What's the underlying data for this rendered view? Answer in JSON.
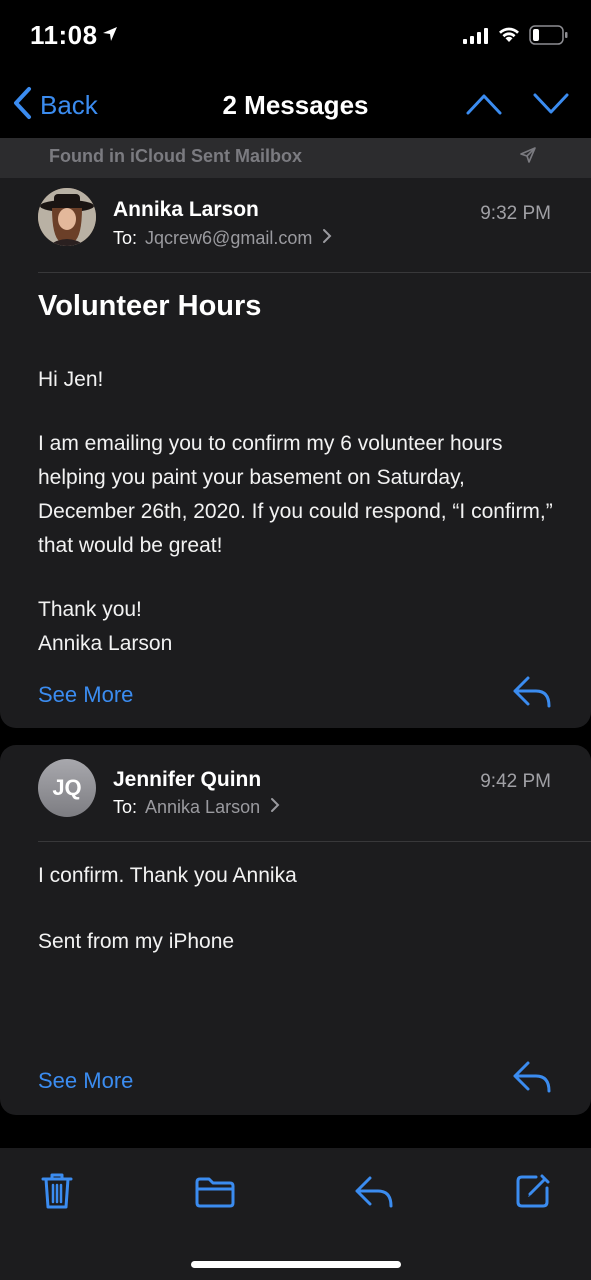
{
  "status_bar": {
    "time": "11:08",
    "icons": [
      "location-arrow-icon",
      "cellular-signal-icon",
      "wifi-icon",
      "battery-icon"
    ]
  },
  "nav": {
    "back_label": "Back",
    "title": "2 Messages"
  },
  "colors": {
    "accent": "#3b8cf0",
    "card_bg": "#1c1c1e",
    "background": "#000000"
  },
  "messages": [
    {
      "found_in": "Found in iCloud Sent Mailbox",
      "sender": "Annika Larson",
      "to_label": "To:",
      "to": "Jqcrew6@gmail.com",
      "time": "9:32 PM",
      "subject": "Volunteer Hours",
      "body": [
        "Hi Jen!",
        "I am emailing you to confirm my 6 volunteer hours helping you paint your basement on Saturday, December 26th, 2020. If you could respond, “I confirm,” that would be great!",
        "Thank you!",
        "Annika Larson"
      ],
      "see_more": "See More"
    },
    {
      "avatar_initials": "JQ",
      "sender": "Jennifer Quinn",
      "to_label": "To:",
      "to": "Annika Larson",
      "time": "9:42 PM",
      "body": [
        "I confirm. Thank you Annika",
        "Sent from my iPhone"
      ],
      "see_more": "See More"
    }
  ],
  "toolbar": {
    "icons": [
      "trash-icon",
      "folder-icon",
      "reply-icon",
      "compose-icon"
    ]
  }
}
